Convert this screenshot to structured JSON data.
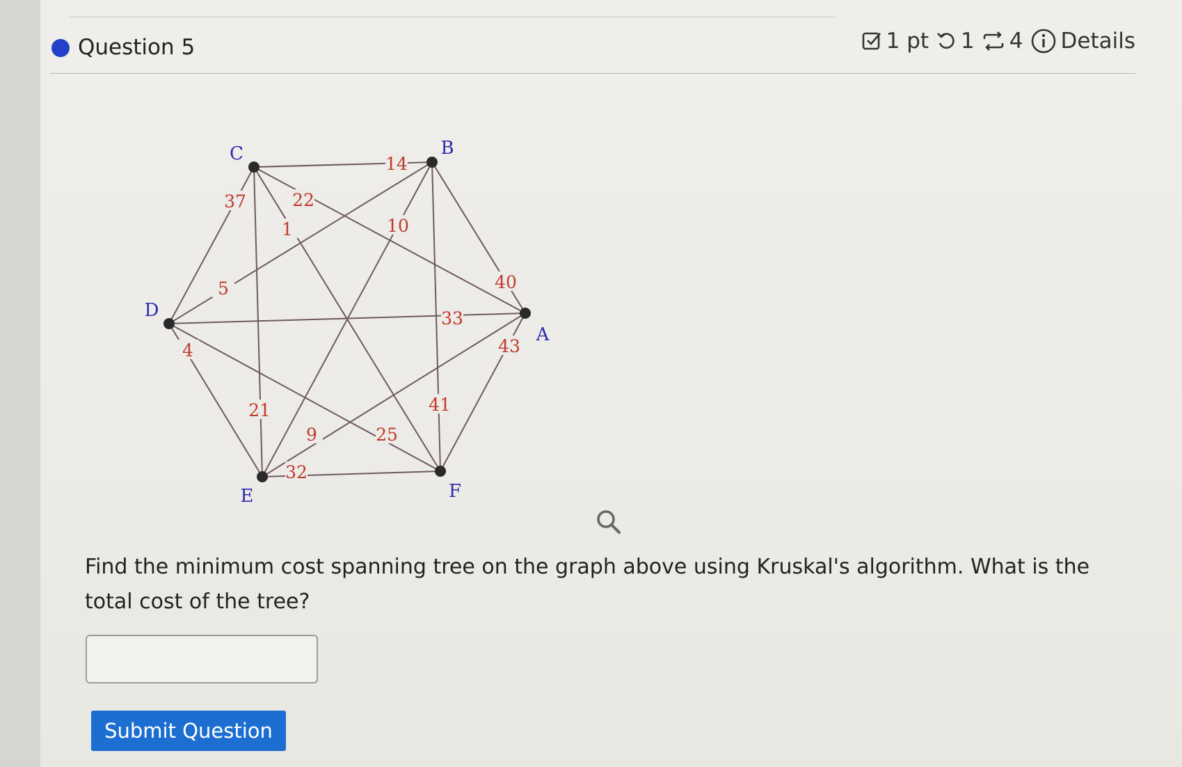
{
  "header": {
    "title": "Question 5",
    "points": "1 pt",
    "retries": "1",
    "versions": "4",
    "details": "Details"
  },
  "graph": {
    "vertices": [
      "A",
      "B",
      "C",
      "D",
      "E",
      "F"
    ],
    "edges": [
      {
        "from": "C",
        "to": "B",
        "weight": "14"
      },
      {
        "from": "C",
        "to": "D",
        "weight": "37"
      },
      {
        "from": "C",
        "to": "A",
        "weight": "22"
      },
      {
        "from": "C",
        "to": "F",
        "weight": "1"
      },
      {
        "from": "C",
        "to": "E",
        "weight": "21"
      },
      {
        "from": "B",
        "to": "E",
        "weight": "10"
      },
      {
        "from": "B",
        "to": "D",
        "weight": "5"
      },
      {
        "from": "B",
        "to": "A",
        "weight": "40"
      },
      {
        "from": "B",
        "to": "F",
        "weight": "41"
      },
      {
        "from": "D",
        "to": "A",
        "weight": "33"
      },
      {
        "from": "D",
        "to": "E",
        "weight": "4"
      },
      {
        "from": "D",
        "to": "F",
        "weight": "25"
      },
      {
        "from": "E",
        "to": "A",
        "weight": "9"
      },
      {
        "from": "A",
        "to": "F",
        "weight": "43"
      },
      {
        "from": "E",
        "to": "F",
        "weight": "32"
      }
    ],
    "colors": {
      "edge": "#6e5a5e",
      "weight": "#c0392b",
      "vertex": "#2a2a2a",
      "label": "#2b2bb0"
    }
  },
  "question": {
    "text": "Find the minimum cost spanning tree on the graph above using Kruskal's algorithm. What is the total cost of the tree?"
  },
  "answer": {
    "value": ""
  },
  "submit_label": "Submit Question",
  "colors": {
    "accent": "#1c6fd1",
    "dot": "#2240c8"
  }
}
